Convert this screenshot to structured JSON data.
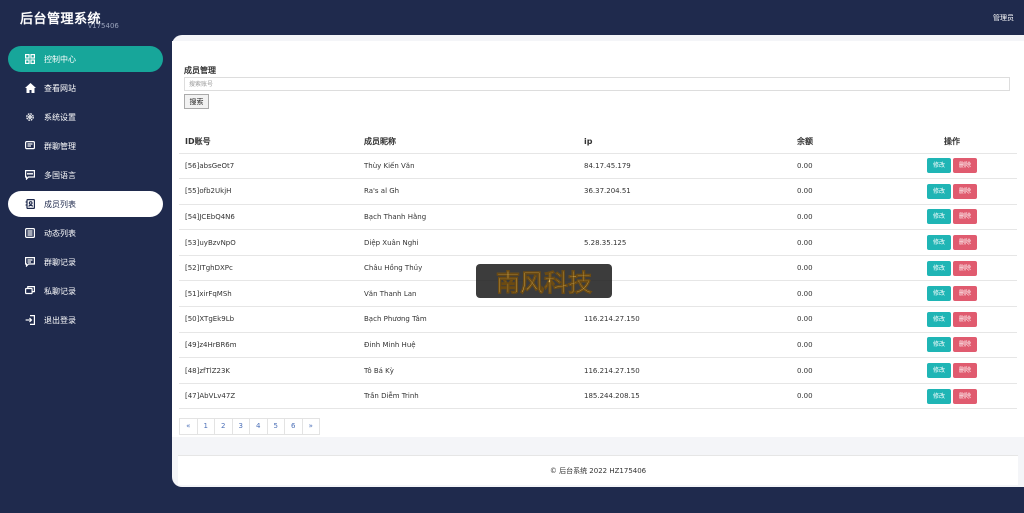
{
  "app": {
    "title": "后台管理系统",
    "version": "v175406",
    "user": "管理员"
  },
  "sidebar": {
    "items": [
      {
        "label": "控制中心",
        "icon": "grid-icon"
      },
      {
        "label": "查看网站",
        "icon": "home-icon"
      },
      {
        "label": "系统设置",
        "icon": "gear-icon"
      },
      {
        "label": "群聊管理",
        "icon": "chat-icon"
      },
      {
        "label": "多国语言",
        "icon": "message-icon"
      },
      {
        "label": "成员列表",
        "icon": "contacts-icon"
      },
      {
        "label": "动态列表",
        "icon": "list-icon"
      },
      {
        "label": "群聊记录",
        "icon": "chat-record-icon"
      },
      {
        "label": "私聊记录",
        "icon": "private-chat-icon"
      },
      {
        "label": "退出登录",
        "icon": "logout-icon"
      }
    ]
  },
  "search": {
    "title": "成员管理",
    "placeholder": "搜索账号",
    "button": "搜索"
  },
  "table": {
    "headers": [
      "ID账号",
      "成员昵称",
      "ip",
      "余额",
      "操作"
    ],
    "edit_label": "修改",
    "delete_label": "删除",
    "rows": [
      {
        "id": "[56]absGeOt7",
        "nick": "Thùy Kiến Văn",
        "ip": "84.17.45.179",
        "balance": "0.00"
      },
      {
        "id": "[55]ofb2UkjH",
        "nick": "Ra's al Gh",
        "ip": "36.37.204.51",
        "balance": "0.00"
      },
      {
        "id": "[54]JCEbQ4N6",
        "nick": "Bạch Thanh Hằng",
        "ip": "",
        "balance": "0.00"
      },
      {
        "id": "[53]uyBzvNpO",
        "nick": "Diệp Xuân Nghi",
        "ip": "5.28.35.125",
        "balance": "0.00"
      },
      {
        "id": "[52]ITghDXPc",
        "nick": "Châu Hồng Thủy",
        "ip": "",
        "balance": "0.00"
      },
      {
        "id": "[51]xirFqMSh",
        "nick": "Văn Thanh Lan",
        "ip": "",
        "balance": "0.00"
      },
      {
        "id": "[50]XTgEk9Lb",
        "nick": "Bạch Phương Tâm",
        "ip": "116.214.27.150",
        "balance": "0.00"
      },
      {
        "id": "[49]z4HrBR6m",
        "nick": "Đinh Minh Huệ",
        "ip": "",
        "balance": "0.00"
      },
      {
        "id": "[48]zfTlZ23K",
        "nick": "Tô Bá Kỳ",
        "ip": "116.214.27.150",
        "balance": "0.00"
      },
      {
        "id": "[47]AbVLv47Z",
        "nick": "Trần Diễm Trinh",
        "ip": "185.244.208.15",
        "balance": "0.00"
      }
    ]
  },
  "pagination": {
    "prev": "«",
    "pages": [
      "1",
      "2",
      "3",
      "4",
      "5",
      "6"
    ],
    "next": "»"
  },
  "footer": {
    "text": "© 后台系统 2022 HZ175406"
  },
  "watermark": {
    "text": "南风科技"
  },
  "colors": {
    "nav_bg": "#1f2a4d",
    "accent": "#17a69a",
    "edit": "#1fb5b5",
    "delete": "#e05b6f"
  }
}
